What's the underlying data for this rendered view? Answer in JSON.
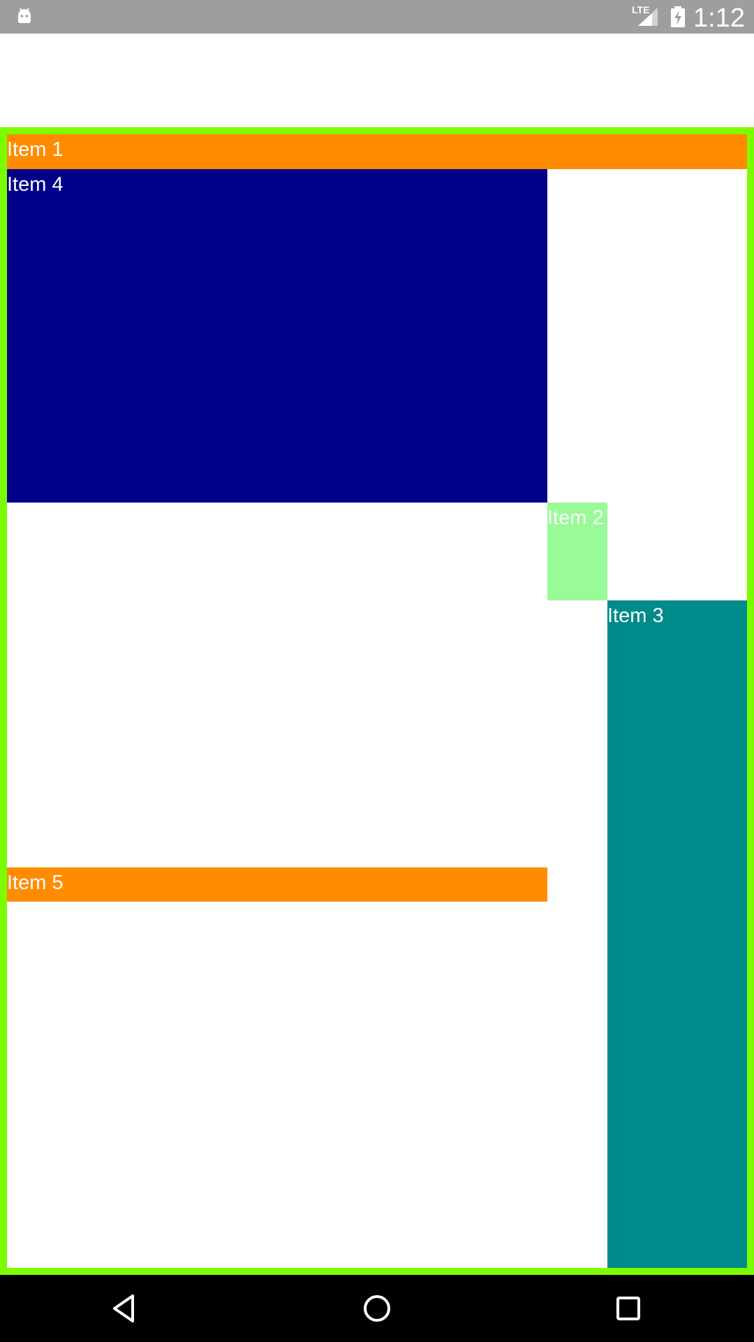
{
  "status_bar": {
    "network_label": "LTE",
    "time": "1:12",
    "background_color": "#9e9e9e",
    "icons": [
      "android-icon",
      "signal-icon",
      "battery-charging-icon"
    ]
  },
  "container": {
    "border_color": "#7cfc00"
  },
  "items": [
    {
      "label": "Item 1",
      "color": "#ff8c00"
    },
    {
      "label": "Item 4",
      "color": "#00008b"
    },
    {
      "label": "Item 2",
      "color": "#98fb98"
    },
    {
      "label": "Item 3",
      "color": "#008b8b"
    },
    {
      "label": "Item 5",
      "color": "#ff8c00"
    }
  ],
  "nav_bar": {
    "buttons": [
      "back-icon",
      "home-icon",
      "recents-icon"
    ]
  }
}
